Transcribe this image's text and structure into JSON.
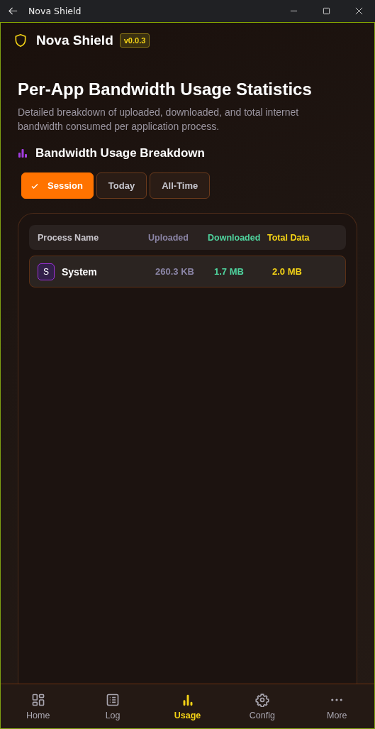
{
  "window": {
    "title": "Nova Shield"
  },
  "header": {
    "app_name": "Nova Shield",
    "version": "v0.0.3"
  },
  "page": {
    "title": "Per-App Bandwidth Usage Statistics",
    "description": "Detailed breakdown of uploaded, downloaded, and total internet bandwidth consumed per application process."
  },
  "section": {
    "title": "Bandwidth Usage Breakdown"
  },
  "filters": [
    {
      "label": "Session",
      "selected": true
    },
    {
      "label": "Today",
      "selected": false
    },
    {
      "label": "All-Time",
      "selected": false
    }
  ],
  "table": {
    "columns": [
      {
        "label": "Process Name",
        "kind": "name"
      },
      {
        "label": "Uploaded",
        "kind": "up"
      },
      {
        "label": "Downloaded",
        "kind": "down"
      },
      {
        "label": "Total Data",
        "kind": "total"
      }
    ],
    "rows": [
      {
        "initial": "S",
        "name": "System",
        "uploaded": "260.3 KB",
        "downloaded": "1.7 MB",
        "total": "2.0 MB"
      }
    ]
  },
  "nav": [
    {
      "label": "Home",
      "kind": "home",
      "selected": false
    },
    {
      "label": "Log",
      "kind": "log",
      "selected": false
    },
    {
      "label": "Usage",
      "kind": "usage",
      "selected": true
    },
    {
      "label": "Config",
      "kind": "config",
      "selected": false
    },
    {
      "label": "More",
      "kind": "more",
      "selected": false
    }
  ]
}
